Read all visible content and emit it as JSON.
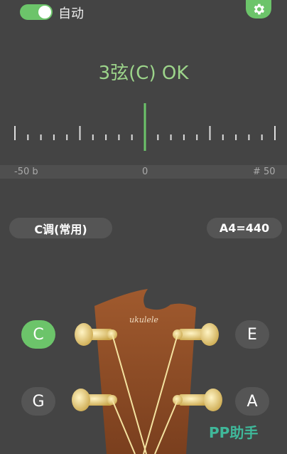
{
  "header": {
    "auto_label": "自动",
    "auto_enabled": true,
    "settings_icon": "gear-icon"
  },
  "tuner": {
    "status": "3弦(C) OK",
    "scale_left": "-50 b",
    "scale_center": "0",
    "scale_right": "# 50"
  },
  "controls": {
    "key_label": "C调(常用)",
    "pitch_label": "A4=440"
  },
  "strings": {
    "c": "C",
    "e": "E",
    "g": "G",
    "a": "A",
    "selected": "C"
  },
  "headstock": {
    "brand": "ukulele"
  },
  "watermark": "PP助手",
  "colors": {
    "accent": "#6cc46a",
    "status_text": "#9cd48a",
    "background": "#444444",
    "headstock": "#8a4a26",
    "tuning_peg": "#e0c070"
  }
}
